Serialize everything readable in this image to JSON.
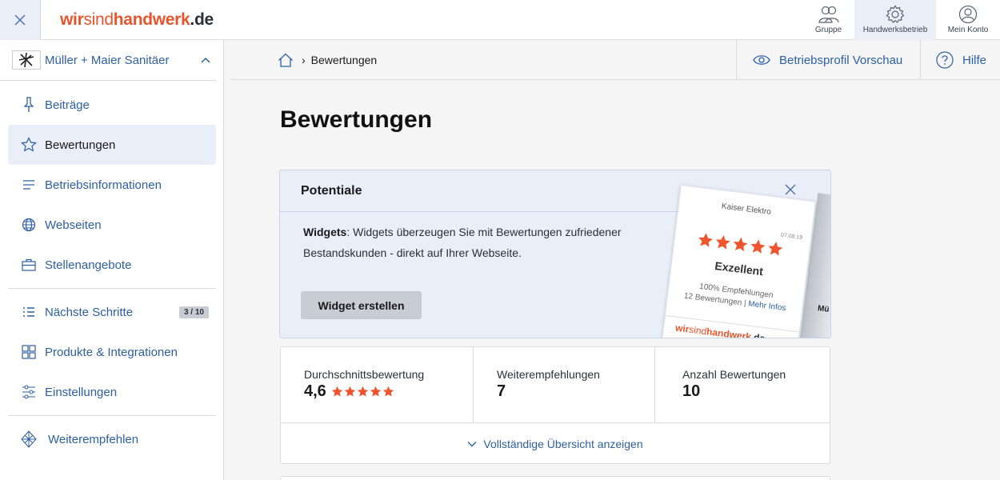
{
  "topbar": {
    "logo": {
      "part1": "wir",
      "part2": "sind",
      "part3": "handwerk",
      "part4": ".de"
    },
    "nav": [
      {
        "label": "Gruppe",
        "icon": "group-icon"
      },
      {
        "label": "Handwerksbetrieb",
        "icon": "gear-icon"
      },
      {
        "label": "Mein Konto",
        "icon": "user-icon"
      }
    ]
  },
  "sidebar": {
    "company": "Müller + Maier Sanitäer",
    "items": [
      {
        "label": "Beiträge",
        "icon": "pin-icon"
      },
      {
        "label": "Bewertungen",
        "icon": "star-icon"
      },
      {
        "label": "Betriebsinformationen",
        "icon": "lines-icon"
      },
      {
        "label": "Webseiten",
        "icon": "globe-icon"
      },
      {
        "label": "Stellenangebote",
        "icon": "briefcase-icon"
      },
      {
        "label": "Nächste Schritte",
        "icon": "list-icon",
        "badge": "3 / 10"
      },
      {
        "label": "Produkte & Integrationen",
        "icon": "grid-icon"
      },
      {
        "label": "Einstellungen",
        "icon": "sliders-icon"
      },
      {
        "label": "Weiterempfehlen",
        "icon": "diamond-icon"
      }
    ]
  },
  "subheader": {
    "breadcrumb_current": "Bewertungen",
    "preview_label": "Betriebsprofil Vorschau",
    "help_label": "Hilfe"
  },
  "main": {
    "title": "Bewertungen",
    "potentiale": {
      "heading": "Potentiale",
      "text_bold": "Widgets",
      "text": ": Widgets überzeugen Sie mit Bewertungen zufriedener Bestandskunden - direkt auf Ihrer Webseite.",
      "button": "Widget erstellen",
      "widget": {
        "name": "Kaiser Elektro",
        "date": "07.08.19",
        "label": "Exzellent",
        "line1": "100% Empfehlungen",
        "line2": "12 Bewertungen",
        "line2_sep": " | ",
        "line2_link": "Mehr Infos",
        "footer_part1": "wir",
        "footer_part2": "sind",
        "footer_part3": "handwerk",
        "footer_part4": ".de",
        "back_text": "Mü"
      }
    },
    "stats": [
      {
        "label": "Durchschnittsbewertung",
        "value": "4,6",
        "stars": 5
      },
      {
        "label": "Weiterempfehlungen",
        "value": "7"
      },
      {
        "label": "Anzahl Bewertungen",
        "value": "10"
      }
    ],
    "stats_more": "Vollständige Übersicht anzeigen"
  },
  "colors": {
    "accent": "#2d5fa3",
    "brand": "#e8542b",
    "star": "#f0542c",
    "active_bg": "#e9eef8"
  }
}
